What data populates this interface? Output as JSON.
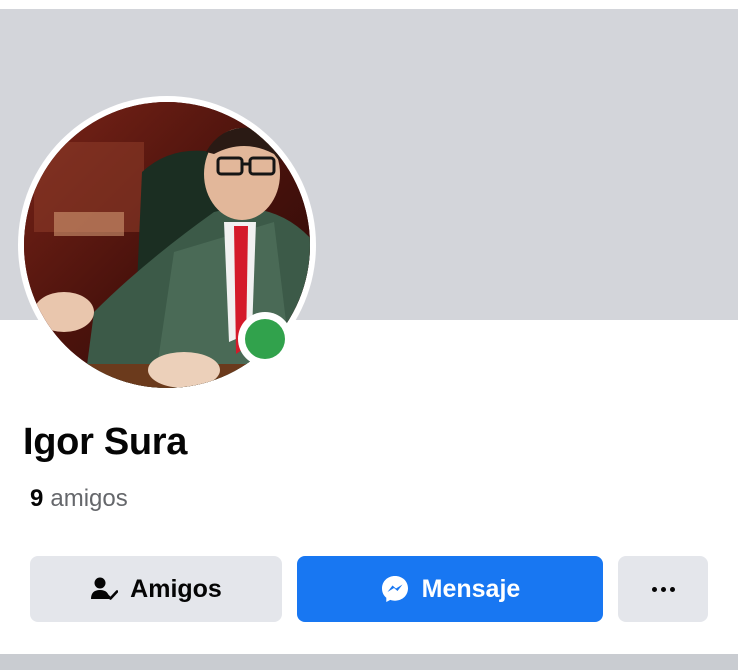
{
  "profile": {
    "name": "Igor Sura",
    "friends_count": "9",
    "friends_label": "amigos",
    "online": true
  },
  "actions": {
    "friends_label": "Amigos",
    "message_label": "Mensaje"
  },
  "colors": {
    "cover": "#d3d5da",
    "primary": "#1877f2",
    "secondary_button": "#e4e6eb",
    "online": "#31a24c",
    "separator": "#c9ccd1"
  },
  "icons": {
    "friends": "friends-check-icon",
    "message": "messenger-icon",
    "more": "more-horizontal-icon"
  }
}
